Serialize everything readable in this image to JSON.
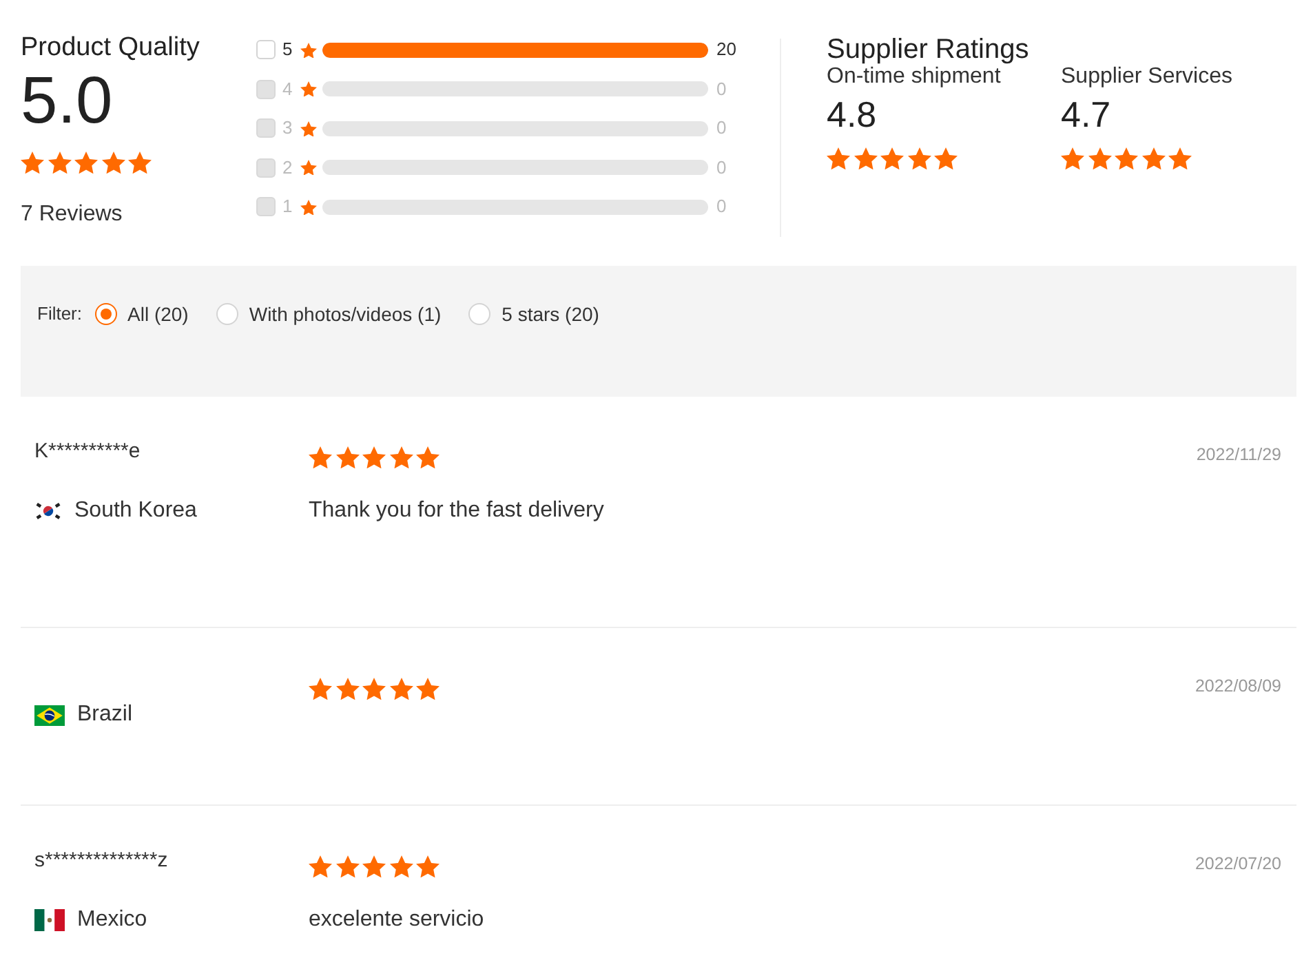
{
  "product_quality": {
    "title": "Product Quality",
    "score": "5.0",
    "stars": 5,
    "reviews": "7 Reviews"
  },
  "breakdown": [
    {
      "label": "5",
      "count": "20",
      "level": 1,
      "checked": false,
      "disabled": false
    },
    {
      "label": "4",
      "count": "0",
      "checked": false,
      "disabled": true
    },
    {
      "label": "3",
      "count": "0",
      "checked": false,
      "disabled": true
    },
    {
      "label": "2",
      "count": "0",
      "checked": false,
      "disabled": true
    },
    {
      "label": "1",
      "count": "0",
      "checked": false,
      "disabled": true
    }
  ],
  "supplier_ratings": {
    "title": "Supplier Ratings",
    "metrics": [
      {
        "label": "On-time shipment",
        "score": "4.8",
        "stars": 5
      },
      {
        "label": "Supplier Services",
        "score": "4.7",
        "stars": 5
      }
    ]
  },
  "filter": {
    "label": "Filter:",
    "options": [
      {
        "label": "All (20)",
        "selected": true
      },
      {
        "label": "With photos/videos (1)",
        "selected": false
      },
      {
        "label": "5 stars (20)",
        "selected": false
      }
    ]
  },
  "reviews": [
    {
      "name": "K**********e",
      "kind": "kr",
      "country": "South Korea",
      "stars": 5,
      "text": "Thank you for the fast delivery",
      "date": "2022/11/29"
    },
    {
      "kind": "br",
      "country": "Brazil",
      "stars": 5,
      "date": "2022/08/09"
    },
    {
      "name": "s**************z",
      "kind": "mx",
      "country": "Mexico",
      "stars": 5,
      "text": "excelente servicio",
      "date": "2022/07/20"
    }
  ]
}
